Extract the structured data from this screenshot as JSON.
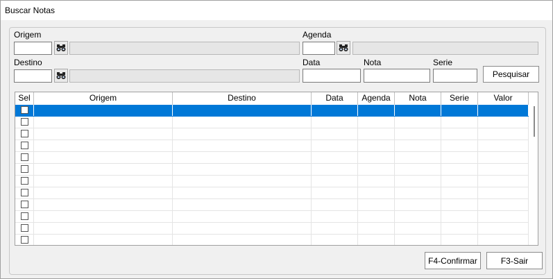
{
  "window": {
    "title": "Buscar Notas"
  },
  "filters": {
    "origem_label": "Origem",
    "agenda_label": "Agenda",
    "destino_label": "Destino",
    "data_label": "Data",
    "nota_label": "Nota",
    "serie_label": "Serie",
    "origem_code": "",
    "agenda_code": "",
    "destino_code": "",
    "data_value": "",
    "nota_value": "",
    "serie_value": "",
    "search_icon": "binoculars-icon"
  },
  "actions": {
    "pesquisar": "Pesquisar",
    "confirmar": "F4-Confirmar",
    "sair": "F3-Sair"
  },
  "grid": {
    "columns": [
      "Sel",
      "Origem",
      "Destino",
      "Data",
      "Agenda",
      "Nota",
      "Serie",
      "Valor"
    ],
    "row_count": 12,
    "selected_row": 0,
    "selected_color": "#0078d7"
  }
}
